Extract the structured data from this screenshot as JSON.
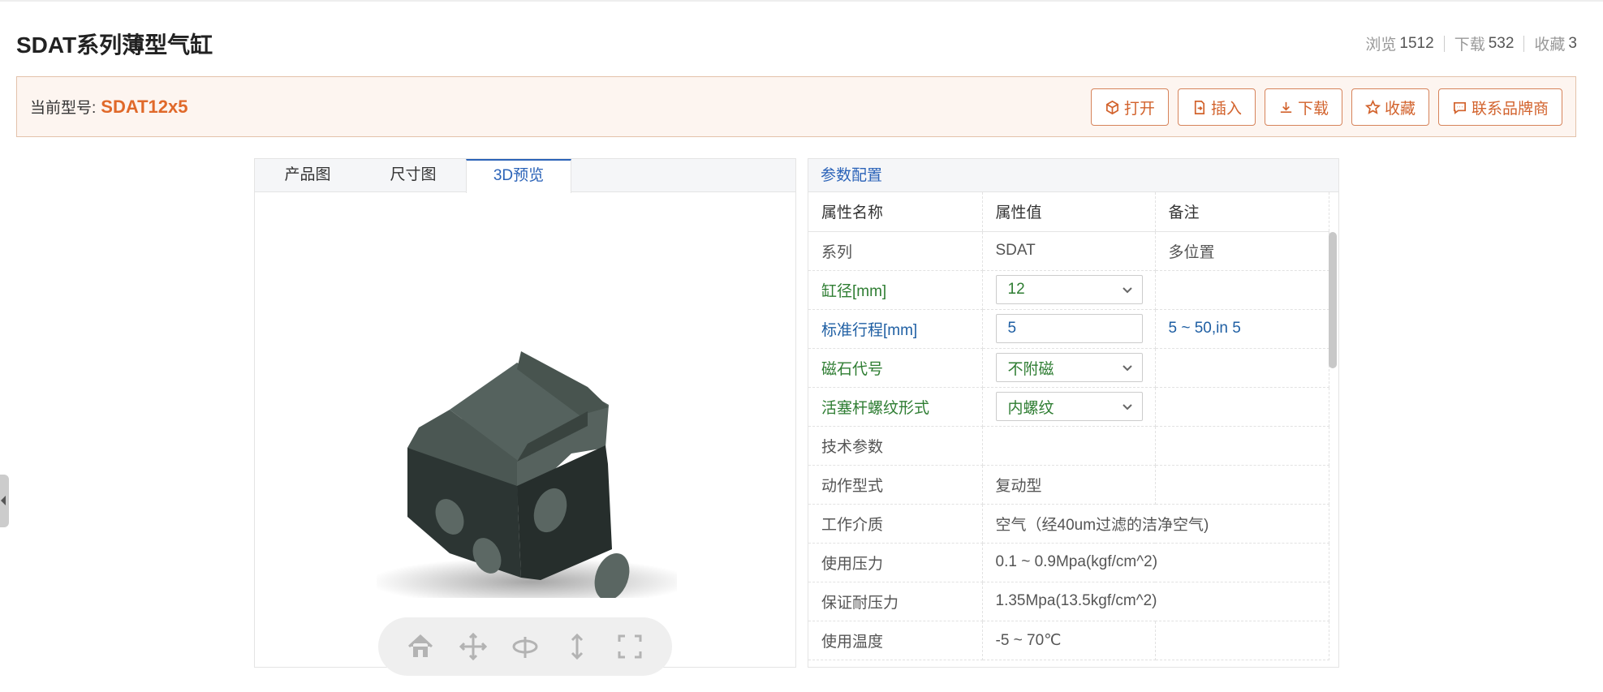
{
  "page": {
    "title": "SDAT系列薄型气缸"
  },
  "stats": [
    {
      "label": "浏览",
      "value": "1512"
    },
    {
      "label": "下载",
      "value": "532"
    },
    {
      "label": "收藏",
      "value": "3"
    }
  ],
  "model": {
    "label": "当前型号:",
    "value": "SDAT12x5"
  },
  "actions": {
    "open": "打开",
    "insert": "插入",
    "download": "下载",
    "favorite": "收藏",
    "contact": "联系品牌商"
  },
  "tabs": [
    "产品图",
    "尺寸图",
    "3D预览"
  ],
  "active_tab": "3D预览",
  "params": {
    "header": "参数配置",
    "columns": [
      "属性名称",
      "属性值",
      "备注"
    ],
    "rows": [
      {
        "name": "系列",
        "value": "SDAT",
        "note": "多位置"
      },
      {
        "name": "缸径[mm]",
        "value": "12",
        "note": ""
      },
      {
        "name": "标准行程[mm]",
        "value": "5",
        "note": "5 ~ 50,in 5"
      },
      {
        "name": "磁石代号",
        "value": "不附磁",
        "note": ""
      },
      {
        "name": "活塞杆螺纹形式",
        "value": "内螺纹",
        "note": ""
      },
      {
        "name": "技术参数",
        "value": "",
        "note": ""
      },
      {
        "name": "动作型式",
        "value": "复动型",
        "note": ""
      },
      {
        "name": "工作介质",
        "value": "空气（经40um过滤的洁净空气)",
        "note": ""
      },
      {
        "name": "使用压力",
        "value": "0.1 ~ 0.9Mpa(kgf/cm^2)",
        "note": ""
      },
      {
        "name": "保证耐压力",
        "value": "1.35Mpa(13.5kgf/cm^2)",
        "note": ""
      },
      {
        "name": "使用温度",
        "value": "-5 ~ 70℃",
        "note": ""
      }
    ]
  },
  "viewer_tools": [
    "home-icon",
    "pan-icon",
    "rotate-icon",
    "zoom-icon",
    "fullscreen-icon"
  ],
  "colors": {
    "accent": "#e0692a",
    "link_blue": "#2b63b8",
    "param_green": "#2e7d32",
    "model_body": "#2f3a37"
  }
}
